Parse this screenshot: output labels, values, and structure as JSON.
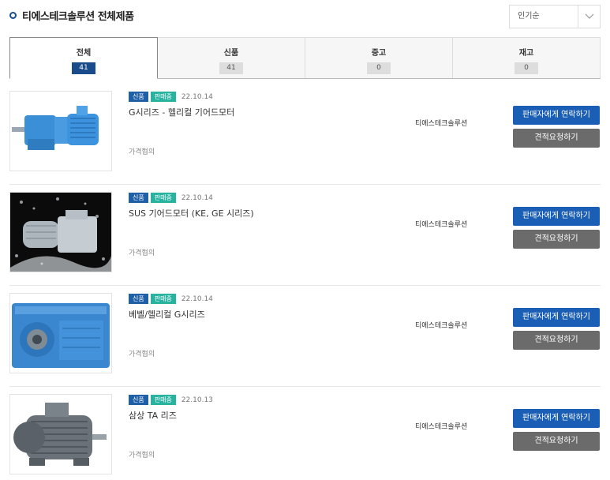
{
  "header": {
    "title": "티에스테크솔루션 전체제품",
    "sort_label": "인기순"
  },
  "tabs": [
    {
      "label": "전체",
      "count": "41"
    },
    {
      "label": "신품",
      "count": "41"
    },
    {
      "label": "중고",
      "count": "0"
    },
    {
      "label": "재고",
      "count": "0"
    }
  ],
  "products": [
    {
      "badge_new": "신품",
      "badge_status": "판매중",
      "date": "22.10.14",
      "name": "G시리즈 - 헬리컬 기어드모터",
      "price": "가격협의",
      "seller": "티에스테크솔루션",
      "contact_label": "판매자에게 연락하기",
      "quote_label": "견적요청하기"
    },
    {
      "badge_new": "신품",
      "badge_status": "판매중",
      "date": "22.10.14",
      "name": "SUS 기어드모터 (KE, GE 시리즈)",
      "price": "가격협의",
      "seller": "티에스테크솔루션",
      "contact_label": "판매자에게 연락하기",
      "quote_label": "견적요청하기"
    },
    {
      "badge_new": "신품",
      "badge_status": "판매중",
      "date": "22.10.14",
      "name": "베벨/헬리컬 G시리즈",
      "price": "가격협의",
      "seller": "티에스테크솔루션",
      "contact_label": "판매자에게 연락하기",
      "quote_label": "견적요청하기"
    },
    {
      "badge_new": "신품",
      "badge_status": "판매중",
      "date": "22.10.13",
      "name": "삼상 TA 리즈",
      "price": "가격협의",
      "seller": "티에스테크솔루션",
      "contact_label": "판매자에게 연락하기",
      "quote_label": "견적요청하기"
    }
  ],
  "colors": {
    "accent": "#1a4c8c",
    "contact_button": "#1a5fb5",
    "quote_button": "#6b6b6b",
    "badge_new": "#1e5fa8",
    "badge_sale": "#26b3a0"
  },
  "icons": {
    "sort": "chevron-down-icon",
    "title": "circle-bullet-icon"
  }
}
